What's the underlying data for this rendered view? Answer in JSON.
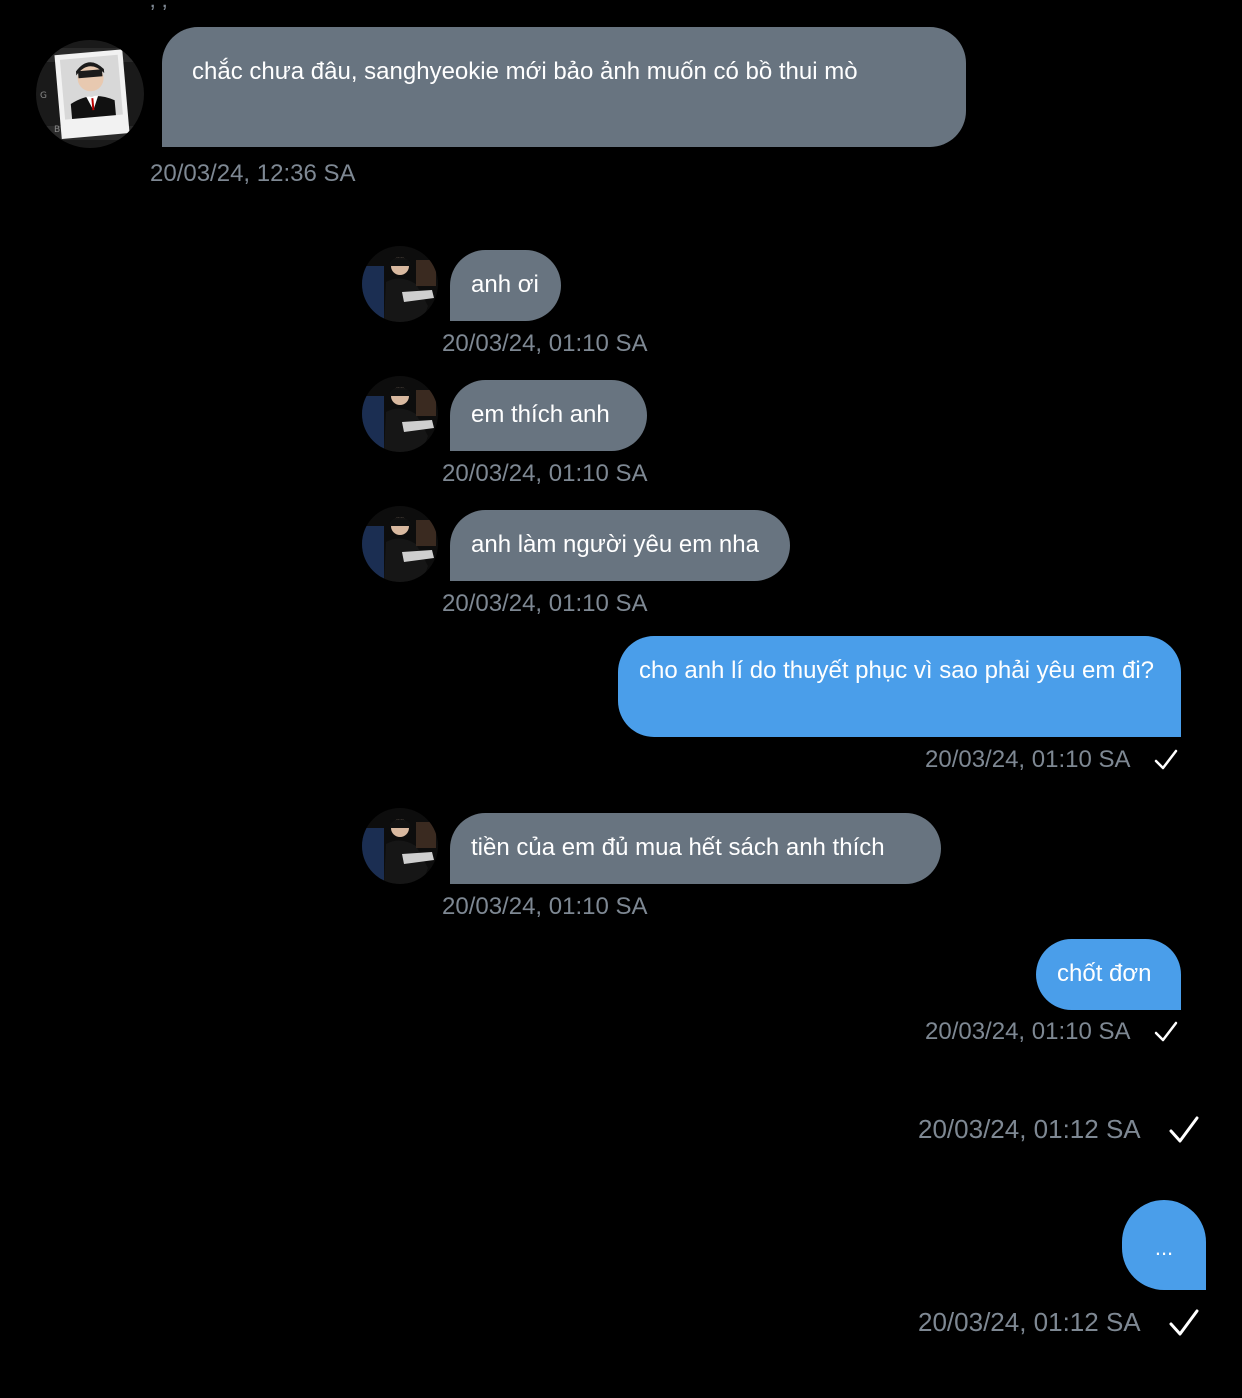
{
  "colors": {
    "background": "#000000",
    "incoming_bubble": "#687480",
    "outgoing_bubble": "#4a9eea",
    "timestamp": "#7e8893",
    "read_check": "#ffffff"
  },
  "messages": [
    {
      "direction": "incoming",
      "avatar": "avatar-photo-polaroid",
      "text": "chắc chưa đâu, sanghyeokie mới bảo ảnh muốn có bồ thui mò",
      "time": "20/03/24, 12:36 SA"
    },
    {
      "direction": "incoming",
      "avatar": "avatar-photo-dark",
      "text": "anh ơi",
      "time": "20/03/24, 01:10 SA"
    },
    {
      "direction": "incoming",
      "avatar": "avatar-photo-dark",
      "text": "em thích anh",
      "time": "20/03/24, 01:10 SA"
    },
    {
      "direction": "incoming",
      "avatar": "avatar-photo-dark",
      "text": "anh làm người yêu em nha",
      "time": "20/03/24, 01:10 SA"
    },
    {
      "direction": "outgoing",
      "text": "cho anh lí do thuyết phục vì sao phải yêu em đi?",
      "time": "20/03/24, 01:10 SA",
      "status_icon": "check-icon"
    },
    {
      "direction": "incoming",
      "avatar": "avatar-photo-dark",
      "text": "tiền của em đủ mua hết sách anh thích",
      "time": "20/03/24, 01:10 SA"
    },
    {
      "direction": "outgoing",
      "text": "chốt đơn",
      "time": "20/03/24, 01:10 SA",
      "status_icon": "check-icon"
    },
    {
      "direction": "outgoing",
      "text": "",
      "time": "20/03/24, 01:12 SA",
      "status_icon": "check-icon"
    },
    {
      "direction": "outgoing",
      "text": "...",
      "time": "20/03/24, 01:12 SA",
      "status_icon": "check-icon"
    }
  ]
}
